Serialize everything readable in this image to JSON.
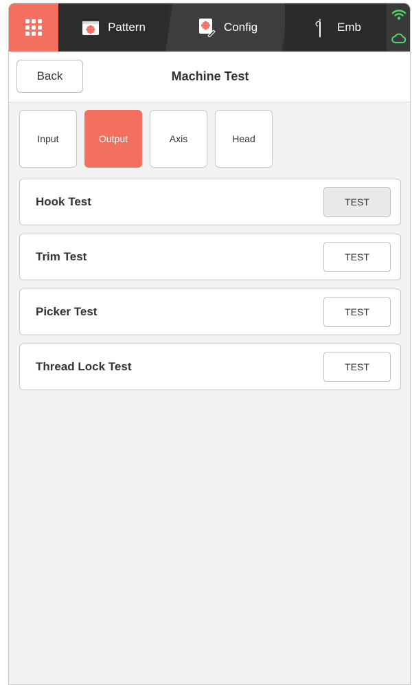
{
  "nav": {
    "apps_icon": "apps-grid-icon",
    "tabs": [
      {
        "label": "Pattern",
        "icon": "pattern-icon"
      },
      {
        "label": "Config",
        "icon": "config-icon"
      },
      {
        "label": "Emb",
        "icon": "needle-icon"
      }
    ],
    "status": {
      "wifi_icon": "wifi-icon",
      "cloud_icon": "cloud-icon",
      "status_color": "#4cd964"
    }
  },
  "header": {
    "back_label": "Back",
    "title": "Machine Test"
  },
  "subtabs": [
    {
      "label": "Input",
      "active": false
    },
    {
      "label": "Output",
      "active": true
    },
    {
      "label": "Axis",
      "active": false
    },
    {
      "label": "Head",
      "active": false
    }
  ],
  "tests": [
    {
      "label": "Hook Test",
      "button": "TEST",
      "pressed": true
    },
    {
      "label": "Trim Test",
      "button": "TEST",
      "pressed": false
    },
    {
      "label": "Picker Test",
      "button": "TEST",
      "pressed": false
    },
    {
      "label": "Thread Lock Test",
      "button": "TEST",
      "pressed": false
    }
  ],
  "colors": {
    "accent": "#f36f5f",
    "topbar": "#2f2f2f",
    "background": "#f2f2f2"
  }
}
